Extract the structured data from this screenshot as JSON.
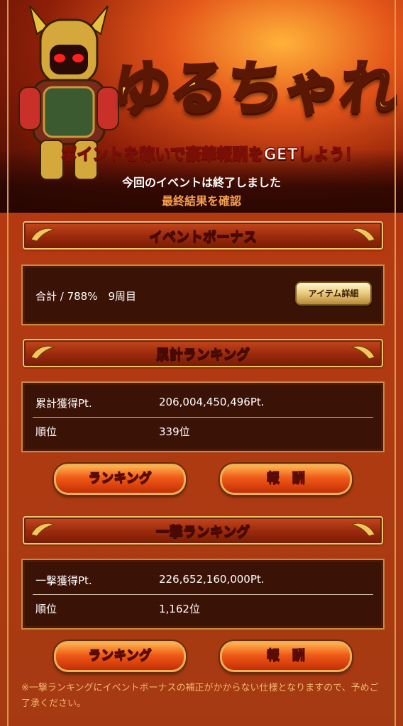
{
  "banner": {
    "logo": "ゆるちゃれ",
    "catchcopy": "ポイントを稼いで豪華報酬をGETしよう！",
    "ended_text": "今回のイベントは終了しました",
    "confirm_link": "最終結果を確認"
  },
  "bonus": {
    "header": "イベントボーナス",
    "summary": "合計 / 788%　9周目",
    "item_button": "アイテム詳細"
  },
  "cumulative": {
    "header": "累計ランキング",
    "points_label": "累計獲得Pt.",
    "points_value": "206,004,450,496Pt.",
    "rank_label": "順位",
    "rank_value": "339位",
    "ranking_button": "ランキング",
    "reward_button": "報　酬"
  },
  "single": {
    "header": "一撃ランキング",
    "points_label": "一撃獲得Pt.",
    "points_value": "226,652,160,000Pt.",
    "rank_label": "順位",
    "rank_value": "1,162位",
    "ranking_button": "ランキング",
    "reward_button": "報　酬"
  },
  "note": "※一撃ランキングにイベントボーナスの補正がかからない仕様となりますので、予めご了承ください。",
  "colors": {
    "background": "#b33a12",
    "panel": "#3b1206",
    "gold_border": "#d69a45",
    "note_text": "#f2b870",
    "button": "#f05a17"
  }
}
